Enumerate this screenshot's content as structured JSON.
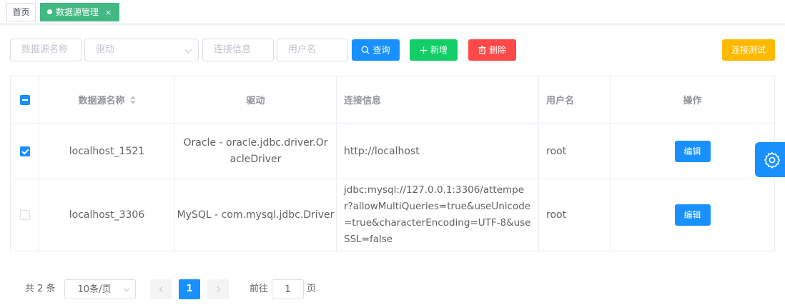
{
  "tabs": {
    "home": "首页",
    "active": "数据源管理",
    "close": "×"
  },
  "search": {
    "name_placeholder": "数据源名称",
    "driver_placeholder": "驱动",
    "conn_placeholder": "连接信息",
    "user_placeholder": "用户名",
    "query_label": "查询",
    "add_label": "新增",
    "delete_label": "删除",
    "test_label": "连接测试"
  },
  "table": {
    "headers": {
      "name": "数据源名称",
      "driver": "驱动",
      "conn": "连接信息",
      "user": "用户名",
      "ops": "操作"
    },
    "rows": [
      {
        "checked": true,
        "name": "localhost_1521",
        "driver": "Oracle - oracle.jdbc.driver.OracleDriver",
        "conn": "http://localhost",
        "user": "root",
        "edit": "编辑"
      },
      {
        "checked": false,
        "name": "localhost_3306",
        "driver": "MySQL - com.mysql.jdbc.Driver",
        "conn": "jdbc:mysql://127.0.0.1:3306/attemper?allowMultiQueries=true&useUnicode=true&characterEncoding=UTF-8&useSSL=false",
        "user": "root",
        "edit": "编辑"
      }
    ]
  },
  "pagination": {
    "total": "共 2 条",
    "page_size": "10条/页",
    "current_page": "1",
    "goto_prefix": "前往",
    "goto_value": "1",
    "goto_suffix": "页"
  },
  "colors": {
    "primary": "#1890ff",
    "success": "#13ce66",
    "danger": "#ff4949",
    "warning": "#ffba00",
    "tab_active": "#42b983"
  }
}
